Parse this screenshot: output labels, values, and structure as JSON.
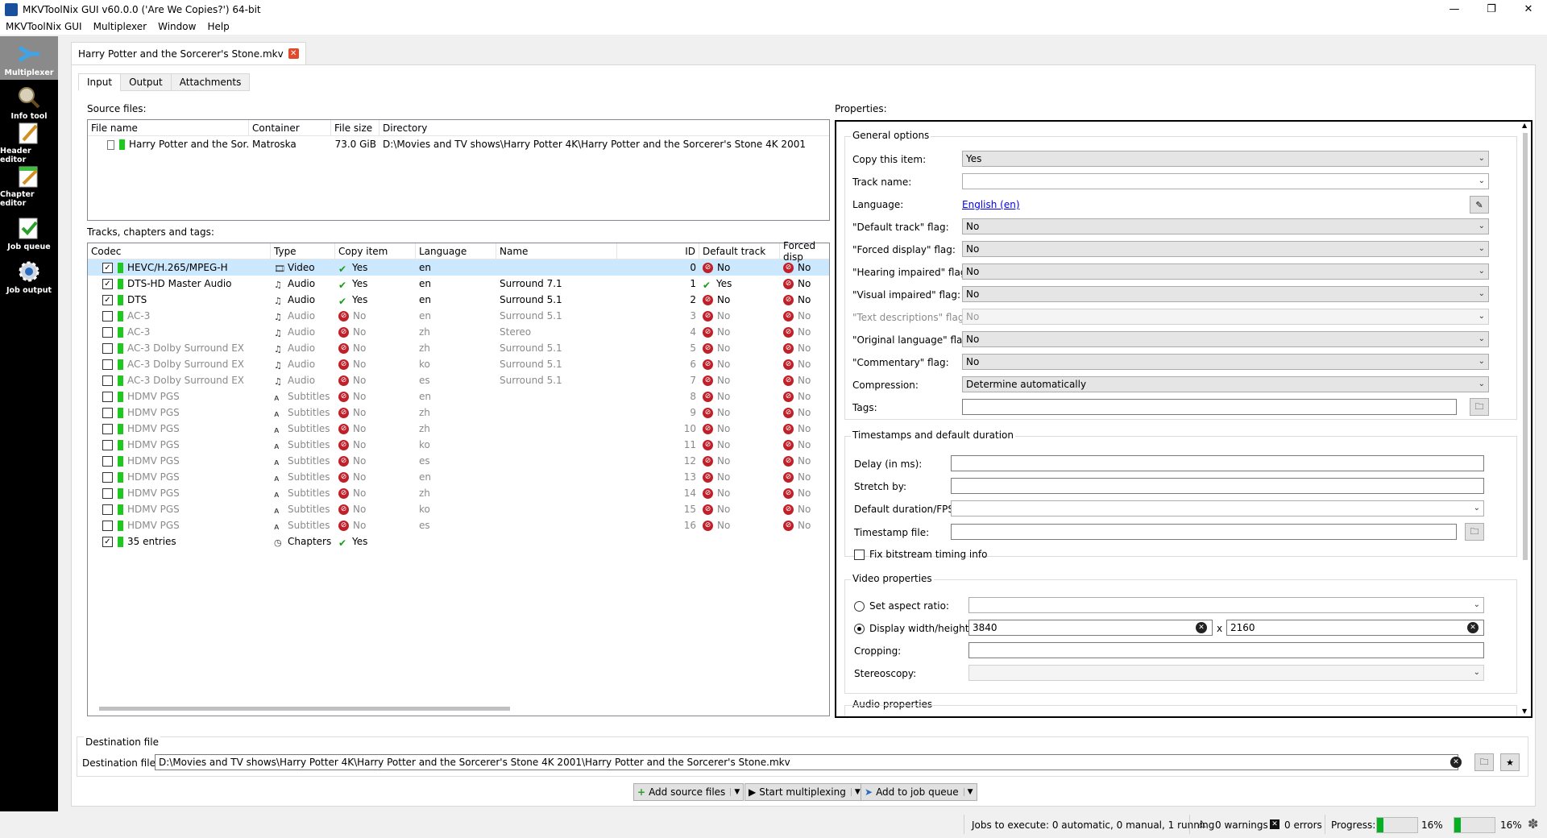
{
  "window": {
    "title": "MKVToolNix GUI v60.0.0 ('Are We Copies?') 64-bit"
  },
  "menu": [
    "MKVToolNix GUI",
    "Multiplexer",
    "Window",
    "Help"
  ],
  "sidebar": [
    {
      "label": "Multiplexer",
      "icon": "multiplexer-icon",
      "active": true
    },
    {
      "label": "Info tool",
      "icon": "magnifier-icon"
    },
    {
      "label": "Header editor",
      "icon": "pencil-icon"
    },
    {
      "label": "Chapter editor",
      "icon": "chapter-icon"
    },
    {
      "label": "Job queue",
      "icon": "checklist-icon"
    },
    {
      "label": "Job output",
      "icon": "gear-icon"
    }
  ],
  "doc_tab": {
    "label": "Harry Potter and the Sorcerer's Stone.mkv"
  },
  "subtabs": [
    "Input",
    "Output",
    "Attachments"
  ],
  "source_files": {
    "label": "Source files:",
    "headers": [
      "File name",
      "Container",
      "File size",
      "Directory"
    ],
    "rows": [
      {
        "name": "Harry Potter and the Sor...",
        "container": "Matroska",
        "size": "73.0 GiB",
        "directory": "D:\\Movies and TV shows\\Harry Potter 4K\\Harry Potter and the Sorcerer's Stone 4K 2001"
      }
    ]
  },
  "tracks": {
    "label": "Tracks, chapters and tags:",
    "headers": [
      "Codec",
      "Type",
      "Copy item",
      "Language",
      "Name",
      "ID",
      "Default track",
      "Forced disp"
    ],
    "rows": [
      {
        "codec": "HEVC/H.265/MPEG-H",
        "type": "Video",
        "copy": "Yes",
        "lang": "en",
        "name": "",
        "id": "0",
        "default": "No",
        "forced": "No",
        "checked": true
      },
      {
        "codec": "DTS-HD Master Audio",
        "type": "Audio",
        "copy": "Yes",
        "lang": "en",
        "name": "Surround 7.1",
        "id": "1",
        "default": "Yes",
        "forced": "No",
        "checked": true
      },
      {
        "codec": "DTS",
        "type": "Audio",
        "copy": "Yes",
        "lang": "en",
        "name": "Surround 5.1",
        "id": "2",
        "default": "No",
        "forced": "No",
        "checked": true
      },
      {
        "codec": "AC-3",
        "type": "Audio",
        "copy": "No",
        "lang": "en",
        "name": "Surround 5.1",
        "id": "3",
        "default": "No",
        "forced": "No",
        "checked": false
      },
      {
        "codec": "AC-3",
        "type": "Audio",
        "copy": "No",
        "lang": "zh",
        "name": "Stereo",
        "id": "4",
        "default": "No",
        "forced": "No",
        "checked": false
      },
      {
        "codec": "AC-3 Dolby Surround EX",
        "type": "Audio",
        "copy": "No",
        "lang": "zh",
        "name": "Surround 5.1",
        "id": "5",
        "default": "No",
        "forced": "No",
        "checked": false
      },
      {
        "codec": "AC-3 Dolby Surround EX",
        "type": "Audio",
        "copy": "No",
        "lang": "ko",
        "name": "Surround 5.1",
        "id": "6",
        "default": "No",
        "forced": "No",
        "checked": false
      },
      {
        "codec": "AC-3 Dolby Surround EX",
        "type": "Audio",
        "copy": "No",
        "lang": "es",
        "name": "Surround 5.1",
        "id": "7",
        "default": "No",
        "forced": "No",
        "checked": false
      },
      {
        "codec": "HDMV PGS",
        "type": "Subtitles",
        "copy": "No",
        "lang": "en",
        "name": "",
        "id": "8",
        "default": "No",
        "forced": "No",
        "checked": false
      },
      {
        "codec": "HDMV PGS",
        "type": "Subtitles",
        "copy": "No",
        "lang": "zh",
        "name": "",
        "id": "9",
        "default": "No",
        "forced": "No",
        "checked": false
      },
      {
        "codec": "HDMV PGS",
        "type": "Subtitles",
        "copy": "No",
        "lang": "zh",
        "name": "",
        "id": "10",
        "default": "No",
        "forced": "No",
        "checked": false
      },
      {
        "codec": "HDMV PGS",
        "type": "Subtitles",
        "copy": "No",
        "lang": "ko",
        "name": "",
        "id": "11",
        "default": "No",
        "forced": "No",
        "checked": false
      },
      {
        "codec": "HDMV PGS",
        "type": "Subtitles",
        "copy": "No",
        "lang": "es",
        "name": "",
        "id": "12",
        "default": "No",
        "forced": "No",
        "checked": false
      },
      {
        "codec": "HDMV PGS",
        "type": "Subtitles",
        "copy": "No",
        "lang": "en",
        "name": "",
        "id": "13",
        "default": "No",
        "forced": "No",
        "checked": false
      },
      {
        "codec": "HDMV PGS",
        "type": "Subtitles",
        "copy": "No",
        "lang": "zh",
        "name": "",
        "id": "14",
        "default": "No",
        "forced": "No",
        "checked": false
      },
      {
        "codec": "HDMV PGS",
        "type": "Subtitles",
        "copy": "No",
        "lang": "ko",
        "name": "",
        "id": "15",
        "default": "No",
        "forced": "No",
        "checked": false
      },
      {
        "codec": "HDMV PGS",
        "type": "Subtitles",
        "copy": "No",
        "lang": "es",
        "name": "",
        "id": "16",
        "default": "No",
        "forced": "No",
        "checked": false
      },
      {
        "codec": "35 entries",
        "type": "Chapters",
        "copy": "Yes",
        "lang": "",
        "name": "",
        "id": "",
        "default": "",
        "forced": "",
        "checked": true
      }
    ]
  },
  "properties": {
    "label": "Properties:",
    "general": {
      "title": "General options",
      "copy_item": {
        "label": "Copy this item:",
        "value": "Yes"
      },
      "track_name": {
        "label": "Track name:",
        "value": ""
      },
      "language": {
        "label": "Language:",
        "value": "English (en)"
      },
      "default_flag": {
        "label": "\"Default track\" flag:",
        "value": "No"
      },
      "forced_flag": {
        "label": "\"Forced display\" flag:",
        "value": "No"
      },
      "hearing_flag": {
        "label": "\"Hearing impaired\" flag:",
        "value": "No"
      },
      "visual_flag": {
        "label": "\"Visual impaired\" flag:",
        "value": "No"
      },
      "text_desc_flag": {
        "label": "\"Text descriptions\" flag:",
        "value": "No"
      },
      "original_flag": {
        "label": "\"Original language\" flag:",
        "value": "No"
      },
      "commentary_flag": {
        "label": "\"Commentary\" flag:",
        "value": "No"
      },
      "compression": {
        "label": "Compression:",
        "value": "Determine automatically"
      },
      "tags": {
        "label": "Tags:",
        "value": ""
      }
    },
    "timestamps": {
      "title": "Timestamps and default duration",
      "delay": "Delay (in ms):",
      "stretch": "Stretch by:",
      "duration": "Default duration/FPS:",
      "ts_file": "Timestamp file:",
      "fix_bitstream": "Fix bitstream timing info"
    },
    "video": {
      "title": "Video properties",
      "aspect": "Set aspect ratio:",
      "display": "Display width/height:",
      "width": "3840",
      "x": "x",
      "height": "2160",
      "cropping": "Cropping:",
      "stereo": "Stereoscopy:"
    },
    "audio": {
      "title": "Audio properties"
    }
  },
  "destination": {
    "group": "Destination file",
    "label": "Destination file:",
    "value": "D:\\Movies and TV shows\\Harry Potter 4K\\Harry Potter and the Sorcerer's Stone 4K 2001\\Harry Potter and the Sorcerer's Stone.mkv"
  },
  "actions": {
    "add_source": "Add source files",
    "start": "Start multiplexing",
    "add_queue": "Add to job queue"
  },
  "status": {
    "jobs": "Jobs to execute:  0 automatic, 0 manual, 1 running",
    "warnings": "0 warnings",
    "errors": "0 errors",
    "progress_label": "Progress:",
    "progress1": "16%",
    "progress2": "16%",
    "progress_value": 0.16
  }
}
